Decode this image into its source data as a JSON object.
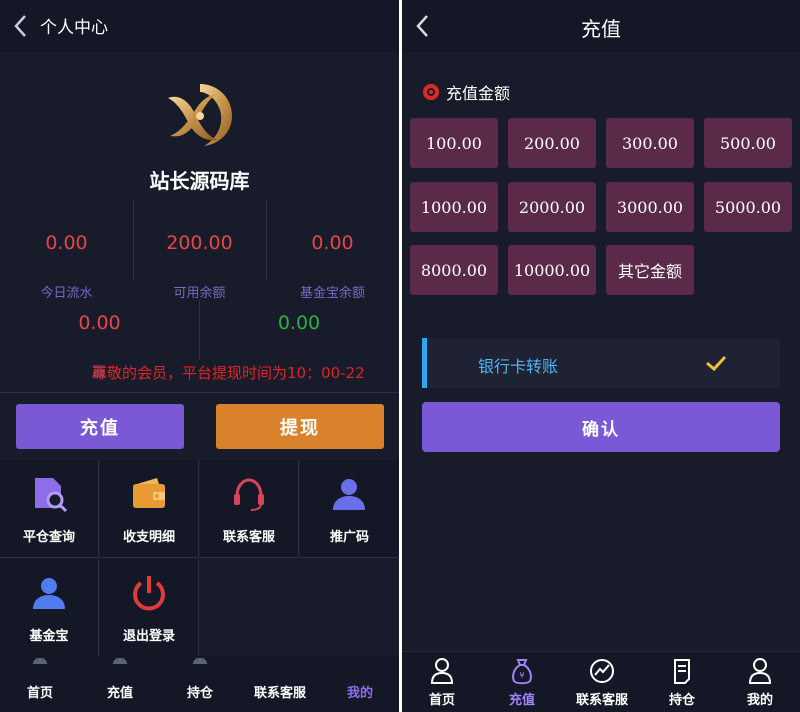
{
  "left": {
    "header": {
      "title": "个人中心"
    },
    "brand": {
      "name": "站长源码库"
    },
    "stats": [
      {
        "value": "0.00",
        "label": "今日流水"
      },
      {
        "value": "200.00",
        "label": "可用余额"
      },
      {
        "value": "0.00",
        "label": "基金宝余额"
      },
      {
        "value": "0.00",
        "label": ""
      },
      {
        "value": "0.00",
        "label": ""
      }
    ],
    "marquee": {
      "prefix": "赢",
      "text": "尊敬的会员，平台提现时间为10：00-22"
    },
    "buttons": {
      "recharge": "充值",
      "withdraw": "提现"
    },
    "grid": [
      {
        "label": "平仓查询",
        "icon": "document-search-icon"
      },
      {
        "label": "收支明细",
        "icon": "wallet-icon"
      },
      {
        "label": "联系客服",
        "icon": "headset-icon"
      },
      {
        "label": "推广码",
        "icon": "user-icon"
      },
      {
        "label": "基金宝",
        "icon": "user-icon"
      },
      {
        "label": "退出登录",
        "icon": "power-icon"
      }
    ],
    "nav": [
      {
        "label": "首页"
      },
      {
        "label": "充值"
      },
      {
        "label": "持仓"
      },
      {
        "label": "联系客服"
      },
      {
        "label": "我的",
        "active": true
      }
    ]
  },
  "right": {
    "header": {
      "title": "充值"
    },
    "amount_section": {
      "title": "充值金额"
    },
    "amounts": [
      "100.00",
      "200.00",
      "300.00",
      "500.00",
      "1000.00",
      "2000.00",
      "3000.00",
      "5000.00",
      "8000.00",
      "10000.00",
      "其它金额"
    ],
    "payment": {
      "method": "银行卡转账",
      "selected": true
    },
    "confirm": "确认",
    "nav": [
      {
        "label": "首页",
        "icon": "user-icon"
      },
      {
        "label": "充值",
        "icon": "money-bag-icon",
        "active": true
      },
      {
        "label": "联系客服",
        "icon": "chart-icon"
      },
      {
        "label": "持仓",
        "icon": "document-icon"
      },
      {
        "label": "我的",
        "icon": "user-icon"
      }
    ]
  },
  "colors": {
    "background": "#181c2a",
    "accent_purple": "#7b59d6",
    "accent_orange": "#d9822b",
    "amount_tile": "#5a2a48",
    "value_red": "#e64545",
    "value_green": "#2fae3e",
    "check_yellow": "#f2c037"
  }
}
